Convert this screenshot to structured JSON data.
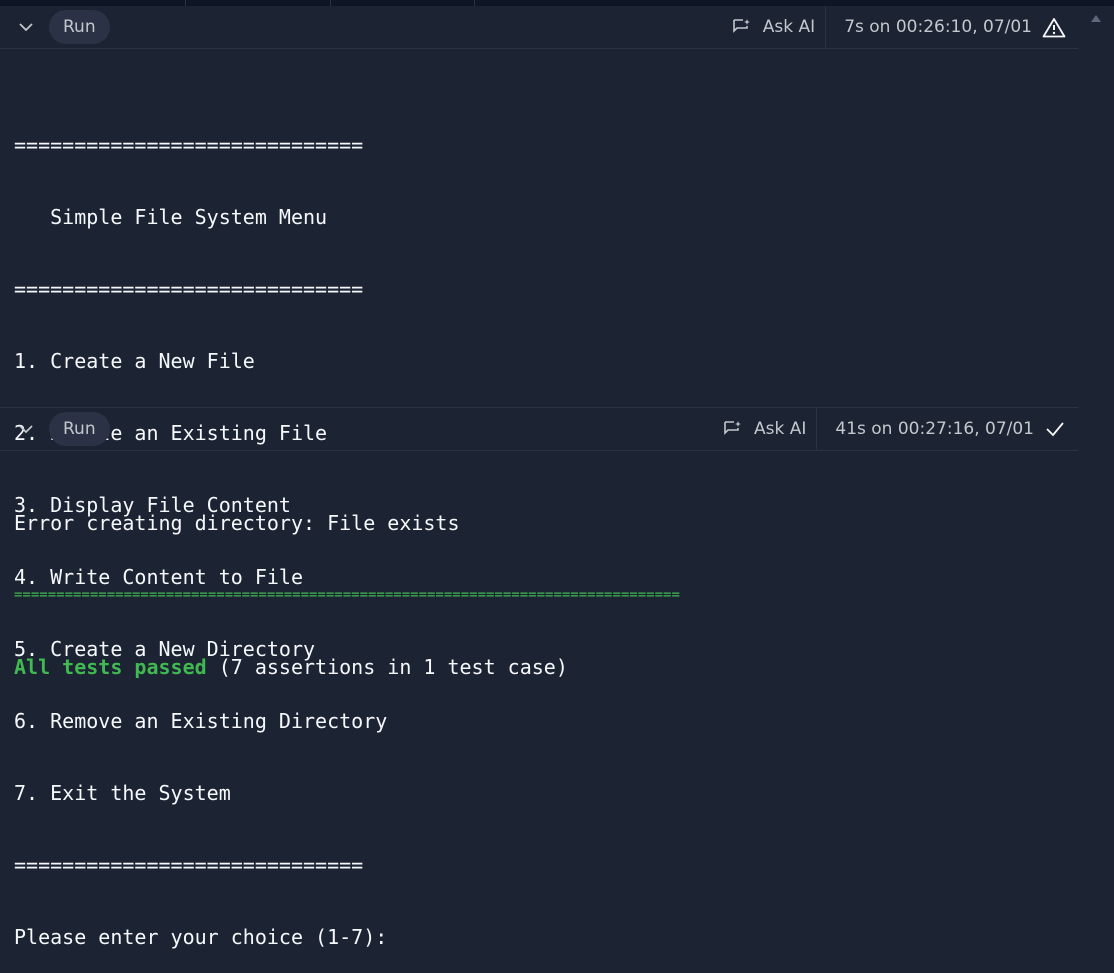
{
  "cells": [
    {
      "run_label": "Run",
      "ask_ai_label": "Ask AI",
      "status_text": "7s on 00:26:10, 07/01",
      "status_icon": "warning-icon",
      "output_lines": [
        "=============================",
        "   Simple File System Menu",
        "=============================",
        "1. Create a New File",
        "2. Delete an Existing File",
        "3. Display File Content",
        "4. Write Content to File",
        "5. Create a New Directory",
        "6. Remove an Existing Directory",
        "7. Exit the System",
        "=============================",
        "Please enter your choice (1-7):"
      ]
    },
    {
      "run_label": "Run",
      "ask_ai_label": "Ask AI",
      "status_text": "41s on 00:27:16, 07/01",
      "status_icon": "check-icon",
      "output_line_1": "Error creating directory: File exists",
      "output_separator": "===============================================================================",
      "result_passed": "All tests passed",
      "result_detail": " (7 assertions in 1 test case)"
    }
  ],
  "colors": {
    "background": "#1c2333",
    "pass_green": "#3fb950",
    "text": "#f5f9fc",
    "muted": "#c2c8cc"
  }
}
